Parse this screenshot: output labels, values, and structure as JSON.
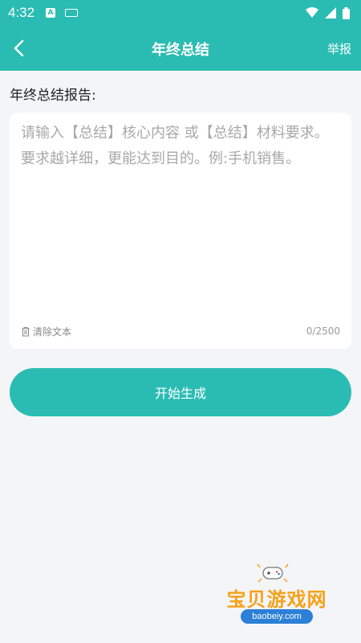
{
  "status_bar": {
    "time": "4:32",
    "notification_badge": "A",
    "icons": [
      "keyboard-icon",
      "wifi-icon",
      "signal-icon",
      "battery-icon"
    ]
  },
  "app_bar": {
    "title": "年终总结",
    "back_icon": "chevron-left-icon",
    "report_label": "举报"
  },
  "form": {
    "section_label": "年终总结报告:",
    "placeholder": "请输入【总结】核心内容 或【总结】材料要求。要求越详细，更能达到目的。例:手机销售。",
    "value": "",
    "clear_label": "清除文本",
    "char_count": "0/2500",
    "submit_label": "开始生成"
  },
  "watermark": {
    "name": "宝贝游戏网",
    "url": "baobeiy.com"
  },
  "colors": {
    "primary": "#2abcb2",
    "background": "#f4f5f7",
    "watermark_text": "#f5a21b",
    "watermark_badge": "#2b7fd6"
  }
}
